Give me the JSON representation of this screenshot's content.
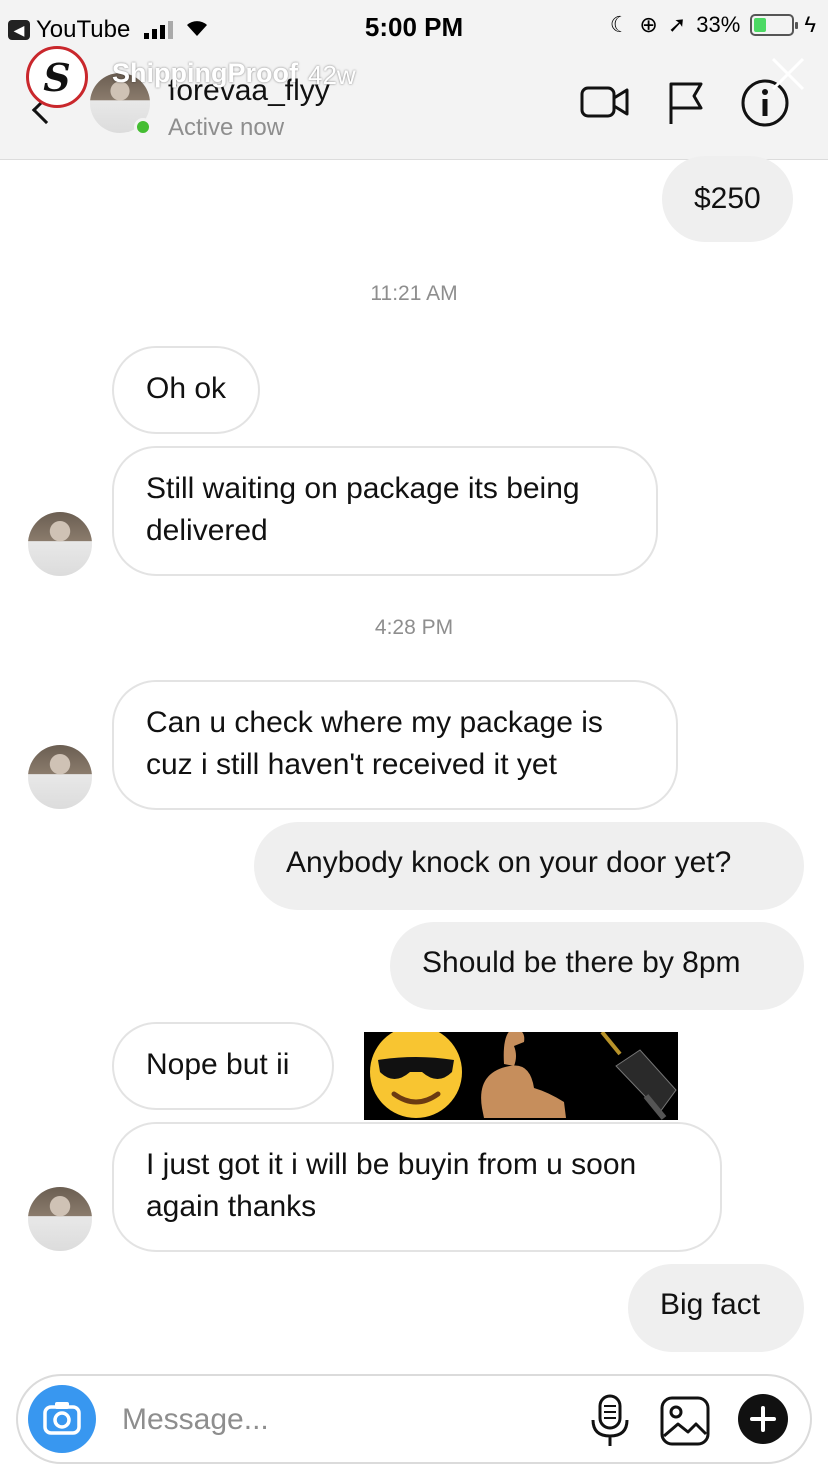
{
  "status_bar": {
    "back_app": "YouTube",
    "time": "5:00 PM",
    "battery_percent": "33%",
    "battery_level": 0.33
  },
  "story_overlay": {
    "account": "ShippingProof",
    "age": "42w"
  },
  "chat_header": {
    "username": "forevaa_flyy",
    "status": "Active now"
  },
  "messages": [
    {
      "from": "me",
      "text": "$250"
    },
    {
      "type": "timestamp",
      "text": "11:21 AM"
    },
    {
      "from": "them",
      "text": "Oh ok"
    },
    {
      "from": "them",
      "text": "Still waiting on package its being delivered"
    },
    {
      "type": "timestamp",
      "text": "4:28 PM"
    },
    {
      "from": "them",
      "text": "Can u check where my package is cuz i still haven't received it yet"
    },
    {
      "from": "me",
      "text": "Anybody knock on your door yet?"
    },
    {
      "from": "me",
      "text": "Should be there by 8pm"
    },
    {
      "from": "them",
      "text": "Nope but ii"
    },
    {
      "from": "them",
      "text": "I just got it i will be buyin from u soon again thanks"
    },
    {
      "from": "me",
      "text": "Big fact"
    }
  ],
  "emoji_sticker": [
    "smiling-face-with-sunglasses-emoji",
    "flexed-biceps-emoji",
    "electric-plug-emoji"
  ],
  "composer": {
    "placeholder": "Message..."
  },
  "colors": {
    "accent_blue": "#3897f0",
    "online_green": "#44bd32",
    "outgoing_bubble": "#efefef",
    "incoming_border": "#e3e3e3"
  }
}
